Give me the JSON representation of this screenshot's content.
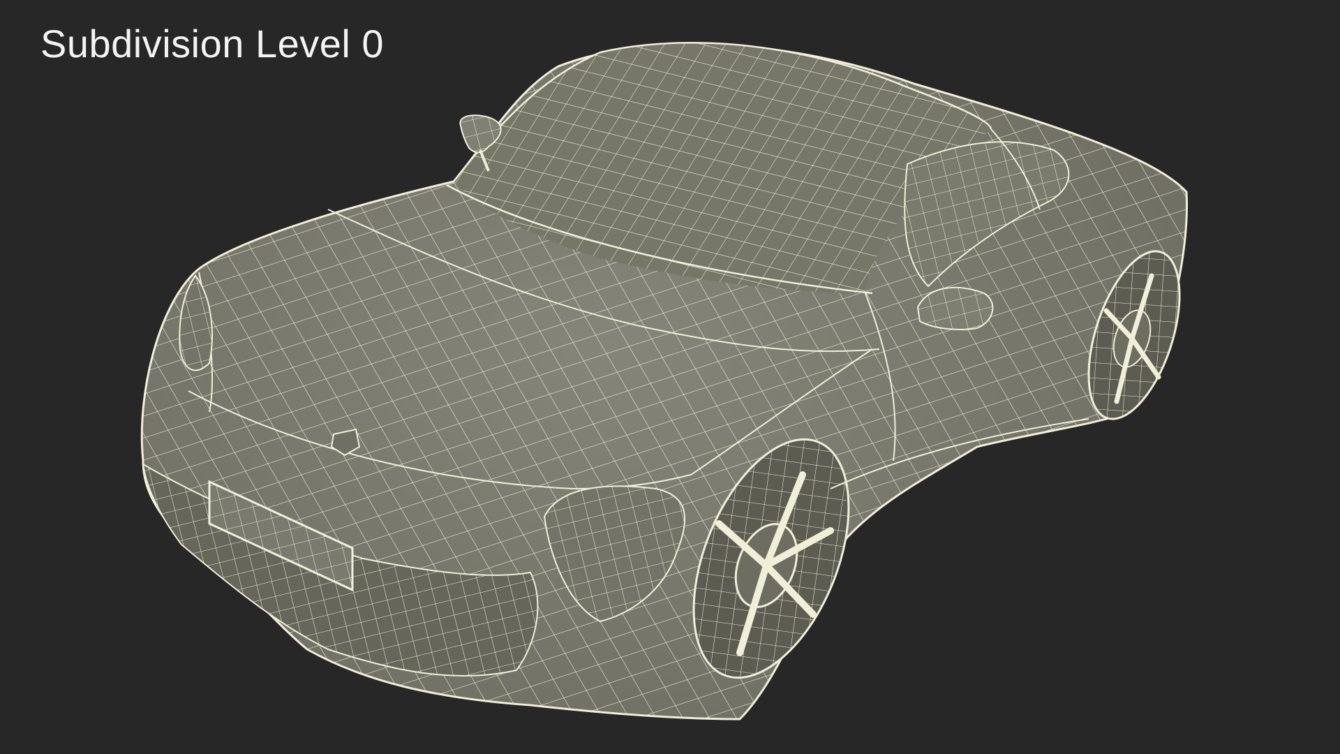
{
  "caption": {
    "text": "Subdivision Level 0"
  },
  "scene": {
    "subject": "sports-car-wireframe-render",
    "colors": {
      "background": "#272727",
      "surface": "#7f7f72",
      "surface_shade": "#6c6c60",
      "wire": "#f1efd8",
      "caption": "#f4f4f4"
    }
  }
}
